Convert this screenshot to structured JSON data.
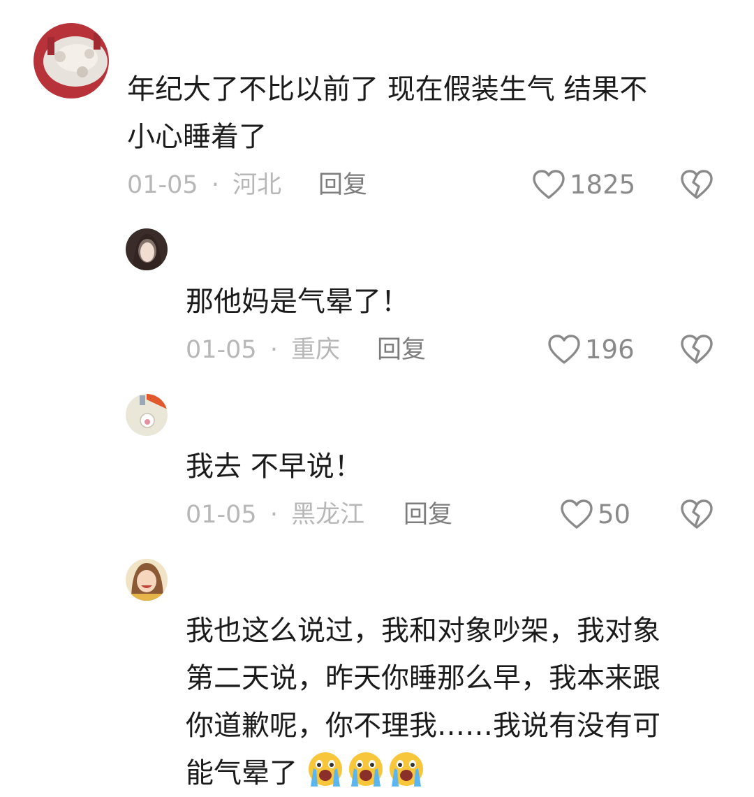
{
  "comments": [
    {
      "text_lines": [
        "年纪大了不比以前了 现在假装生气 结果不",
        "小心睡着了"
      ],
      "date": "01-05",
      "location": "河北",
      "reply_label": "回复",
      "likes": "1825"
    },
    {
      "text_lines": [
        "那他妈是气晕了！"
      ],
      "date": "01-05",
      "location": "重庆",
      "reply_label": "回复",
      "likes": "196"
    },
    {
      "text_lines": [
        "我去 不早说！"
      ],
      "date": "01-05",
      "location": "黑龙江",
      "reply_label": "回复",
      "likes": "50"
    },
    {
      "text_lines": [
        "我也这么说过，我和对象吵架，我对象",
        "第二天说，昨天你睡那么早，我本来跟",
        "你道歉呢，你不理我……我说有没有可",
        "能气晕了"
      ],
      "emoji": "crying-face-emoji"
    }
  ],
  "separator": "·",
  "icons": [
    "heart-outline-icon",
    "broken-heart-icon"
  ],
  "colors": {
    "text": "#1b1b1b",
    "meta": "#b7b7b7",
    "reply": "#7d7d7d",
    "icon": "#8a8a8a"
  }
}
